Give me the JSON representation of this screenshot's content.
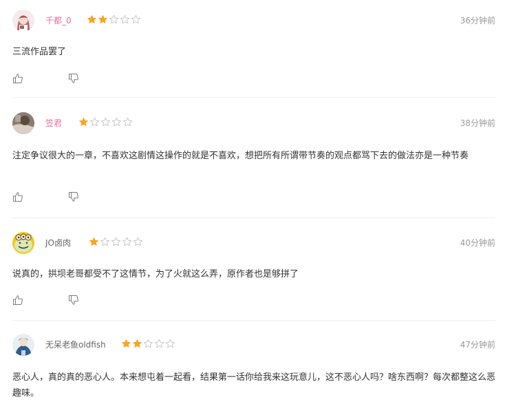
{
  "colors": {
    "star_on": "#f6a623",
    "star_off": "#c8c8c8",
    "username_pink": "#e0709d",
    "username_plain": "#666666",
    "time": "#999999",
    "divider": "#eeeeee"
  },
  "comments": [
    {
      "username": "千都_0",
      "rating": 2,
      "max_rating": 5,
      "time": "36分钟前",
      "text": "三流作品罢了"
    },
    {
      "username": "笠君",
      "rating": 1,
      "max_rating": 5,
      "time": "38分钟前",
      "text": "注定争议很大的一章，不喜欢这剧情这操作的就是不喜欢，想把所有所谓带节奏的观点都骂下去的做法亦是一种节奏"
    },
    {
      "username": "JO卤肉",
      "rating": 1,
      "max_rating": 5,
      "time": "40分钟前",
      "text": "说真的，拱坝老哥都受不了这情节，为了火就这么弄，原作者也是够拼了"
    },
    {
      "username": "无呆老鱼oldfish",
      "rating": 2,
      "max_rating": 5,
      "time": "47分钟前",
      "text": "恶心人，真的真的恶心人。本来想屯着一起看，结果第一话你给我来这玩意儿，这不恶心人吗？啥东西啊？每次都整这么恶趣味。"
    }
  ]
}
